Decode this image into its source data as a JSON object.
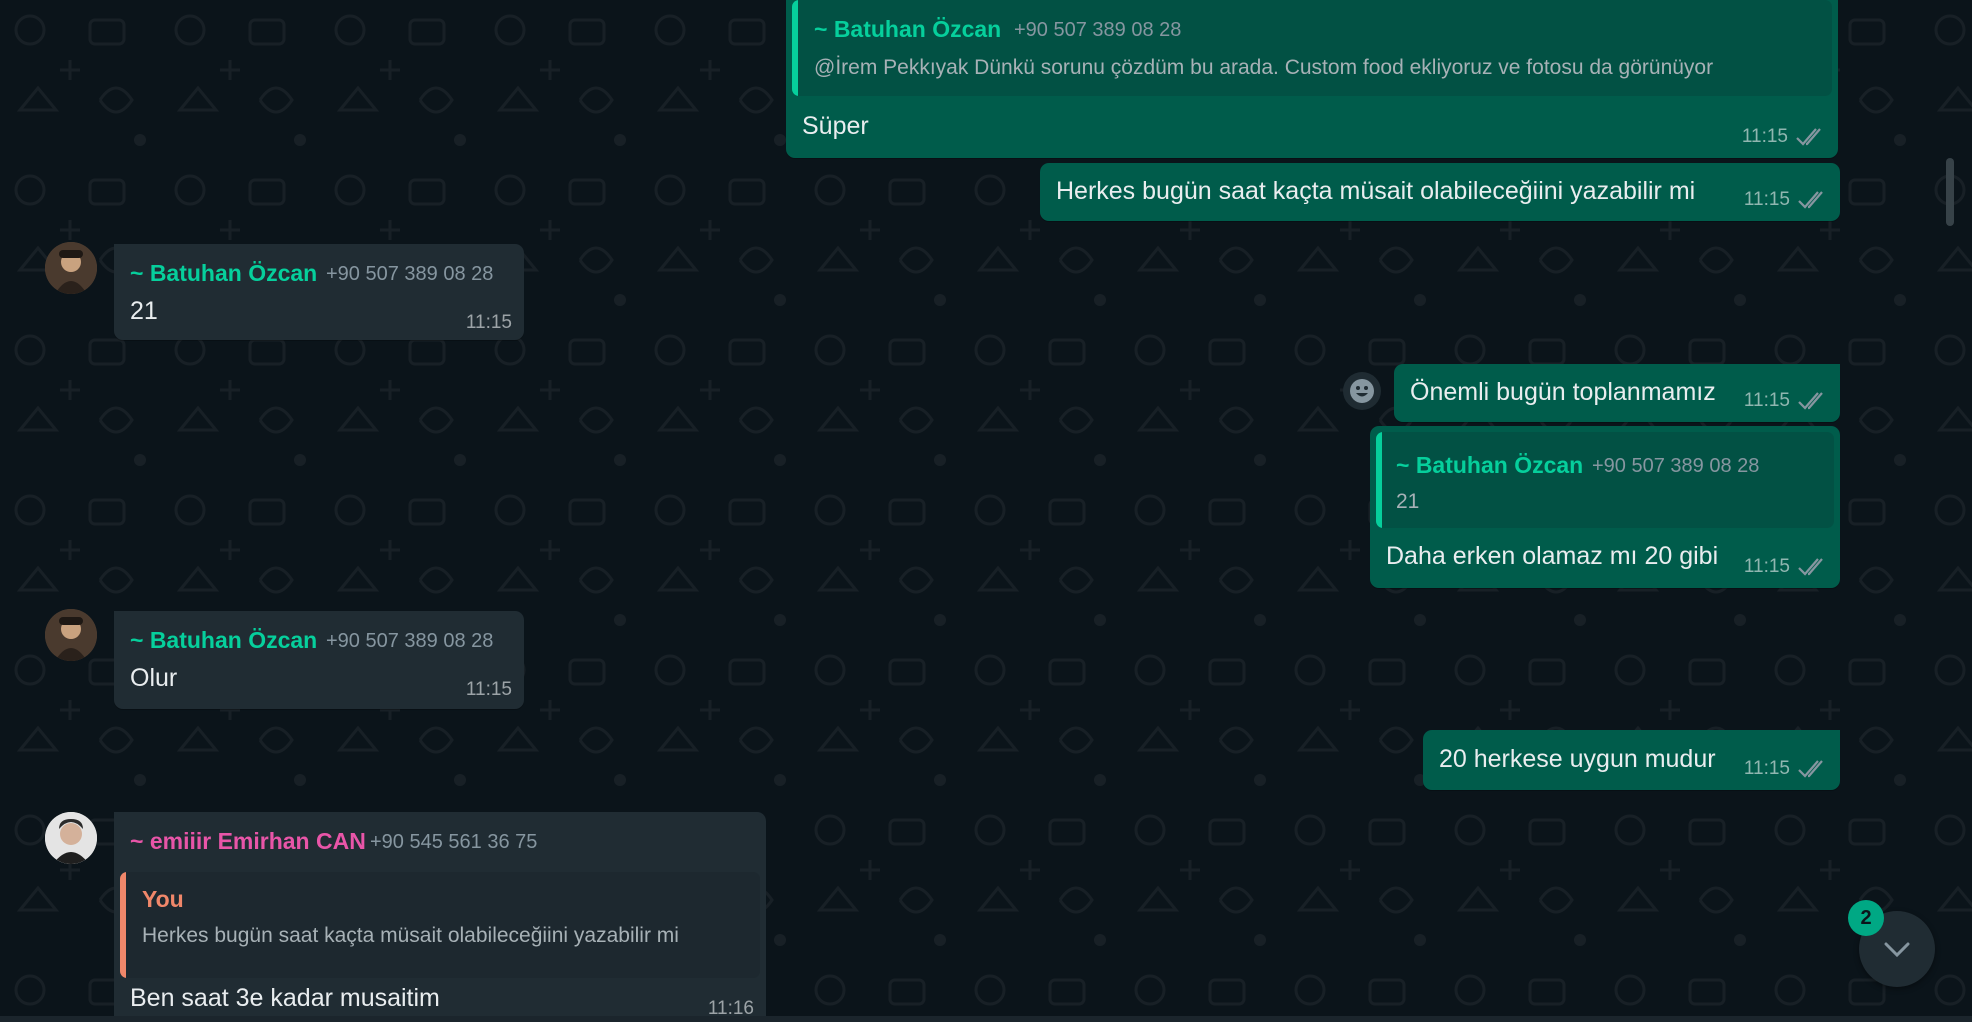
{
  "colors": {
    "outgoing_bubble": "#005c4b",
    "incoming_bubble": "#202c33",
    "sender_green": "#06cf9c",
    "sender_pink": "#e855a8",
    "quote_you": "#f0876a",
    "unread_badge": "#00a884"
  },
  "messages": {
    "m1": {
      "quote_sender": "~ Batuhan Özcan",
      "quote_phone": "+90 507 389 08 28",
      "quote_text": "@İrem Pekkıyak Dünkü sorunu çözdüm bu arada. Custom food ekliyoruz ve fotosu da görünüyor",
      "text": "Süper",
      "time": "11:15"
    },
    "m2": {
      "text": "Herkes bugün saat kaçta müsait olabileceğiini yazabilir mi",
      "time": "11:15"
    },
    "m3": {
      "sender": "~ Batuhan Özcan",
      "phone": "+90 507 389 08 28",
      "text": "21",
      "time": "11:15"
    },
    "m4": {
      "text": "Önemli bugün toplanmamız",
      "time": "11:15"
    },
    "m5": {
      "quote_sender": "~ Batuhan Özcan",
      "quote_phone": "+90 507 389 08 28",
      "quote_text": "21",
      "text": "Daha erken olamaz mı 20 gibi",
      "time": "11:15"
    },
    "m6": {
      "sender": "~ Batuhan Özcan",
      "phone": "+90 507 389 08 28",
      "text": "Olur",
      "time": "11:15"
    },
    "m7": {
      "text": "20 herkese uygun mudur",
      "time": "11:15"
    },
    "m8": {
      "sender": "~ emiiir Emirhan CAN",
      "phone": "+90 545 561 36 75",
      "quote_sender": "You",
      "quote_text": "Herkes bugün saat kaçta müsait olabileceğiini yazabilir mi",
      "text": "Ben saat 3e kadar musaitim",
      "time": "11:16"
    }
  },
  "scroll_down": {
    "unread_count": "2",
    "icon": "chevron-down-icon"
  },
  "icons": {
    "read_receipt": "double-check-icon",
    "emoji": "emoji-icon"
  }
}
